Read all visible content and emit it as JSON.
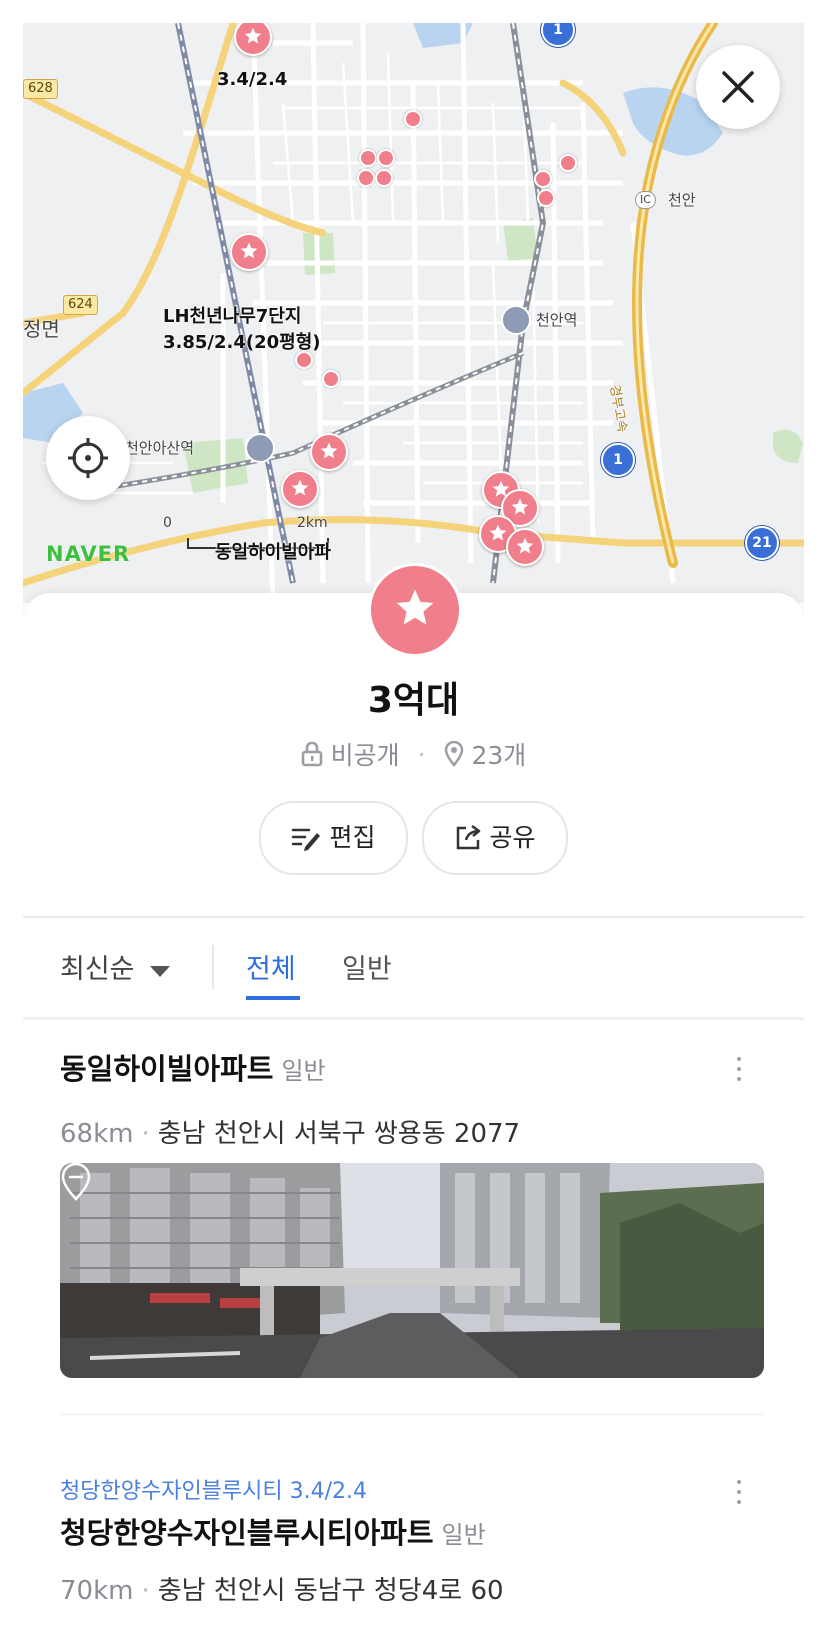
{
  "map": {
    "labels": {
      "top_pin": "3.4/2.4",
      "lh_name": "LH천년나무7단지",
      "lh_value": "3.85/2.4(20평형)",
      "cheonan_asan_station": "천안아산역",
      "cheonan_station": "천안역",
      "ic": "천안",
      "ic_badge": "IC",
      "left_edge": "정면",
      "expressway": "경부고속",
      "donil_short": "동일하이빌아파",
      "scale_zero": "0",
      "scale_km": "2km"
    },
    "road_badges": [
      "628",
      "624"
    ],
    "route_numbers": [
      "1",
      "1",
      "21"
    ],
    "logo": "NAVER",
    "colors": {
      "pin": "#f07f8b",
      "land": "#eff0f2",
      "road": "#f4d37a",
      "water": "#b9d4f0",
      "park": "#cfe6c4"
    }
  },
  "folder": {
    "title": "3억대",
    "privacy": "비공개",
    "count": "23개",
    "edit_label": "편집",
    "share_label": "공유",
    "icon": "star-icon",
    "color": "#f07f8b"
  },
  "filter": {
    "sort_label": "최신순",
    "tabs": [
      {
        "label": "전체",
        "active": true
      },
      {
        "label": "일반",
        "active": false
      }
    ]
  },
  "items": [
    {
      "name": "동일하이빌아파트",
      "category": "일반",
      "distance": "68km",
      "address": "충남 천안시 서북구 쌍용동 2077",
      "has_photo": true
    },
    {
      "memo": "청당한양수자인블루시티 3.4/2.4",
      "name": "청당한양수자인블루시티아파트",
      "category": "일반",
      "distance": "70km",
      "address": "충남 천안시 동남구 청당4로 60"
    }
  ],
  "accent_color": "#2e6fe0"
}
